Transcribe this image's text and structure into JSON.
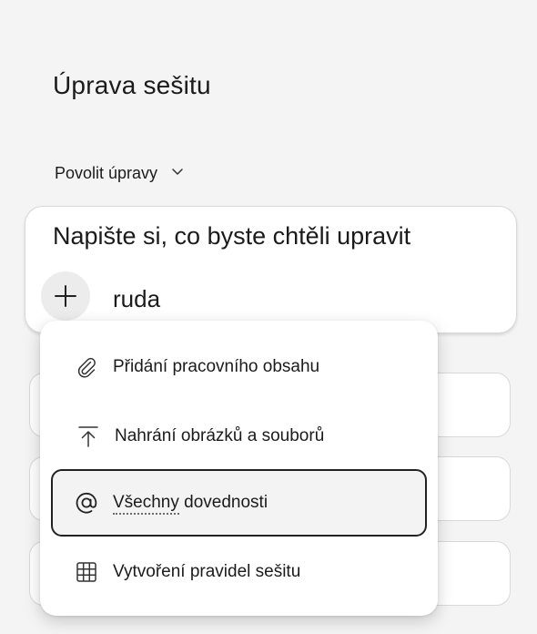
{
  "page": {
    "title": "Úprava sešitu"
  },
  "mode_select": {
    "label": "Povolit úpravy"
  },
  "prompt": {
    "heading": "Napište si, co byste chtěli upravit",
    "input_value": "ruda"
  },
  "menu": {
    "items": [
      {
        "label": "Přidání pracovního obsahu",
        "icon": "paperclip-icon"
      },
      {
        "label": "Nahrání obrázků a souborů",
        "icon": "upload-icon"
      },
      {
        "label_part1": "Všechny",
        "label_part2": " dovednosti",
        "icon": "at-icon",
        "active": true
      },
      {
        "label": "Vytvoření pravidel sešitu",
        "icon": "table-grid-icon"
      }
    ]
  }
}
